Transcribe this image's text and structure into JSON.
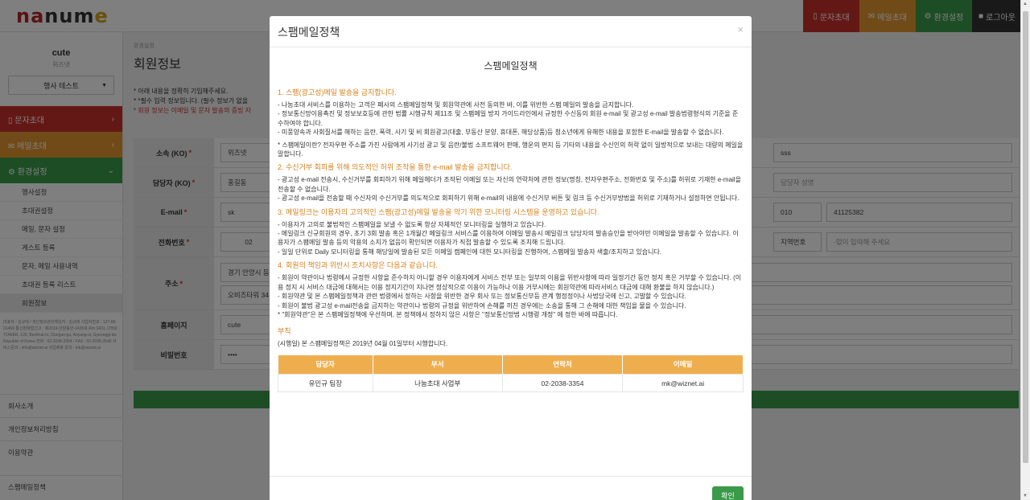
{
  "logo": {
    "part1": "na",
    "part2": "num",
    "part3": "e"
  },
  "topnav": {
    "btn1": "문자초대",
    "btn2": "메일초대",
    "btn3": "환경설정",
    "btn4": "로그아웃"
  },
  "sidebar": {
    "user_name": "cute",
    "user_sub": "위즈넷",
    "event_select": "행사 테스트",
    "menu_sms": "문자초대",
    "menu_mail": "메일초대",
    "menu_settings": "환경설정",
    "sub_items": [
      "행사설정",
      "초대권설정",
      "메일, 문자 설정",
      "게스트 등록",
      "문자, 메일 사용내역",
      "초대권 등록 리스트",
      "회원정보"
    ],
    "company_info": "대표자 : 김규태 / 개인정보관리책임자 : 김규태 사업자번호 : 127-86-01469 통신판매업신고 : 제2019-안양동안-1435호 Rm 3401, O'BIZ TOWER, 126, Beolmal-ro, Dongan-gu, Anyang-si, Gyeonggi-do, Republic of Korea 전화 : 02-2038-3354 / FAX : 02-2038-3546 서비스문의 : info@wiznet.ai 사업제휴 문의 : mk@wiznet.ai",
    "footer_links": [
      "회사소개",
      "개인정보처리방침",
      "이용약관",
      "스팸메일정책"
    ]
  },
  "main": {
    "breadcrumb": "환경설정",
    "title": "회원정보",
    "notice1": "* 아래 내용을 정확히 기입해주세요.",
    "notice2": "* *필수 입력 정보입니다. (필수 정보가 없을",
    "notice3": "* 회원 정보는 이메일 및 문자 발송의 증빙 자",
    "labels": [
      "소속 (KO)",
      "담당자 (KO)",
      "E-mail",
      "전화번호",
      "주소",
      "홈페이지",
      "비밀번호"
    ],
    "req": "*",
    "org_value": "위즈넷",
    "org_en": "sss",
    "manager_value": "홍길동",
    "manager_en_ph": "담당자 성명",
    "email_value": "sk",
    "phone_prefix": "010",
    "phone_value": "41125382",
    "tel_area": "02",
    "region_select": "지역번호",
    "region_ph": "-없이 입력해 주세요",
    "addr1": "경기 안양시 동",
    "addr2": "오비즈타워 34",
    "homepage": "cute",
    "password": "••••"
  },
  "modal": {
    "title": "스팸메일정책",
    "close": "×",
    "doc_title": "스팸메일정책",
    "s1": "1. 스팸(광고성)메일 발송을 금지합니다.",
    "s1_p1": "- 나눔초대 서비스를 이용하는 고객은 폐사의 스팸메일정책 및 회원약관에 사전 동의한 바, 이를 위반한 스팸 메일의 발송을 금지합니다.",
    "s1_p2": "- 정보통신망이용촉진 및 정보보호등에 관한 법률 시행규칙 제11조 및 스팸메일 방지 가이드라인에서 규정한 수신동의 회원 e-mail 및 광고성 e-mail 발송법령형식의 기준을 준수하여야 합니다.",
    "s1_p3": "- 미풍양속과 사회질서를 해하는 음란, 폭력, 사기 및 비 회원광고(대출, 부동산 분양, 휴대폰, 해당상품)등 청소년에게 유해한 내용을 포함한 E-mail을 발송할 수 없습니다.",
    "s1_p4": "* 스팸메일이란? 전자우편 주소를 가진 사람에게 사기성 광고 및 음란/불법 소프트웨어 판매, 행운의 편지 등 기타의 내용을 수신인의 허락 없이 일방적으로 보내는 대량의 메일을 말합니다.",
    "s2": "2. 수신거부 회피를 위해 의도적인 허위 조작을 통한 e-mail 발송을 금지합니다.",
    "s2_p1": "- 광고성 e-mail 전송시, 수신거부를 회피하기 위해 메일헤더가 조작된 이메일 또는 자신의 연락처에 관한 정보(명칭, 전자우편주소, 전화번호 및 주소)를 허위로 기재한 e-mail을 전송할 수 없습니다.",
    "s2_p2": "- 광고성 e-mail을 전송할 때 수신자의 수신거부를 의도적으로 회피하기 위해 e-mail의 내용에 수신거부 버튼 및 링크 등 수신거부방법을 허위로 기재하거나 설정하면 안됩니다.",
    "s3": "3. 메일링크는 이용자의 고의적인 스팸(광고성)메일 발송을 막기 위한 모니터링 시스템을 운영하고 있습니다.",
    "s3_p1": "- 이용자가 고의로 불법적인 스팸메일을 보낼 수 없도록 항상 자체적인 모니터링을 실행하고 있습니다.",
    "s3_p2": "- 메일링크 신규회원의 경우, 초기 3회 발송 혹은 1개월간 메일링크 서비스를 이용하여 이메일 발송시 메일링크 담당자의 발송승인을 받아야만 이메일을 발송할 수 있습니다. 이용자가 스팸메일 발송 등의 악용의 소지가 없음이 확인되면 이용자가 직접 발송할 수 있도록 조치해 드립니다.",
    "s3_p3": "- 일일 단위로 Daily 모니터링을 통해 해당일에 발송된 모든 이메일 캠페인에 대한 모니터링을 진행하여, 스팸메일 발송자 색출/조치하고 있습니다.",
    "s4": "4. 회원의 책임과 위반시 조치사항은 다음과 같습니다.",
    "s4_p1": "- 회원이 약관이나 법령에서 규정한 사항을 준수하지 아니할 경우 이용자에게 서비스 전부 또는 일부의 이용을 위반사항에 따라 일정기간 동안 정지 혹은 거부할 수 있습니다. (이용 정지 시 서비스 대금에 대해서는 이용 정지기간이 지나면 정상적으로 이용이 가능하나 이용 거부시에는 회원약관에 따라서비스 대금에 대해 환불을 하지 않습니다.)",
    "s4_p2": "- 회원약관 및 본 스팸메일정책과 관련 법령에서 정하는 사항을 위반한 경우 회사 또는 정보통신부등 관계 행정정이나 사법당국에 신고, 고발할 수 있습니다.",
    "s4_p3": "- 회원이 불법 광고성 e-mail전송을 금지하는 약관이나 법령의 규정을 위반하여 손해를 끼친 경우에는 소송을 통해 그 손해에 대한 책임을 물을 수 있습니다.",
    "s4_p4": "* \"회원약관\"은 본 스팸메일정책에 우선하며, 본 정책에서 정하지 않은 사항은 \"정보통신망법 시행령 개정\" 에 정한 바에 따릅니다.",
    "appendix": "부칙",
    "effective": "(시행일) 본 스팸메일정책은 2019년 04월 01일부터 시행합니다.",
    "table_headers": [
      "담당자",
      "부서",
      "연락처",
      "이메일"
    ],
    "table_row": [
      "유민규 팀장",
      "나눔초대 사업부",
      "02-2038-3354",
      "mk@wiznet.ai"
    ],
    "ok": "확인"
  },
  "colors": {
    "red": "#c9302c",
    "orange": "#e2962f",
    "green": "#3a9a4a",
    "accent_text": "#d4811b",
    "table_header": "#efae4e"
  }
}
